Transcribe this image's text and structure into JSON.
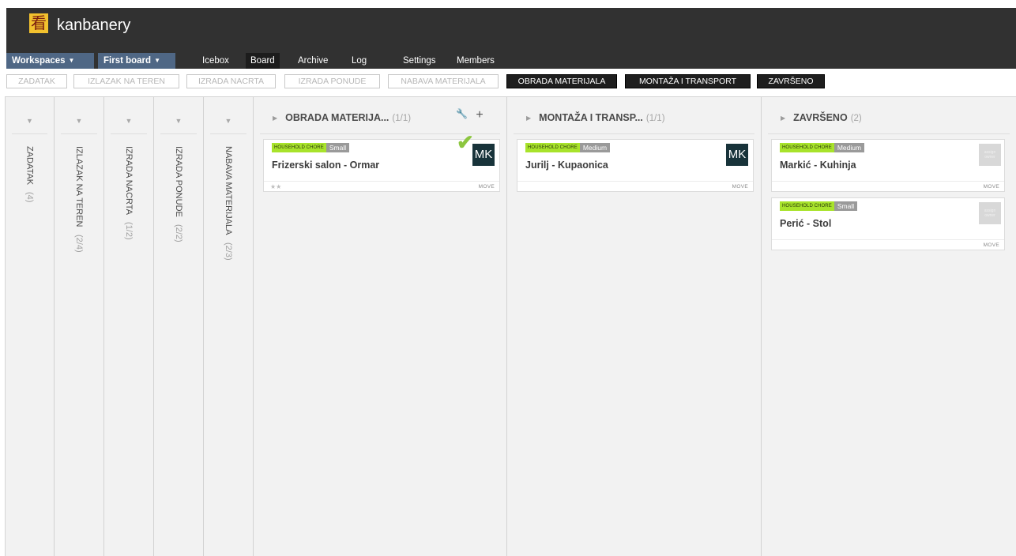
{
  "header": {
    "logo_char": "看",
    "app_name": "kanbanery",
    "workspaces_label": "Workspaces",
    "board_dropdown_label": "First board",
    "caret": "▼",
    "nav": [
      {
        "label": "Icebox",
        "active": false
      },
      {
        "label": "Board",
        "active": true
      },
      {
        "label": "Archive",
        "active": false
      },
      {
        "label": "Log",
        "active": false
      },
      {
        "label": "Settings",
        "active": false
      },
      {
        "label": "Members",
        "active": false
      }
    ]
  },
  "filters": [
    {
      "label": "ZADATAK",
      "active": false
    },
    {
      "label": "IZLAZAK NA TEREN",
      "active": false
    },
    {
      "label": "IZRADA NACRTA",
      "active": false
    },
    {
      "label": "IZRADA PONUDE",
      "active": false
    },
    {
      "label": "NABAVA MATERIJALA",
      "active": false
    },
    {
      "label": "OBRADA MATERIJALA",
      "active": true
    },
    {
      "label": "MONTAŽA I TRANSPORT",
      "active": true
    },
    {
      "label": "ZAVRŠENO",
      "active": true
    }
  ],
  "collapsed_columns": [
    {
      "name": "ZADATAK",
      "count": "(4)"
    },
    {
      "name": "IZLAZAK NA TEREN",
      "count": "(2/4)"
    },
    {
      "name": "IZRADA NACRTA",
      "count": "(1/2)"
    },
    {
      "name": "IZRADA PONUDE",
      "count": "(2/2)"
    },
    {
      "name": "NABAVA MATERIJALA",
      "count": "(2/3)"
    }
  ],
  "columns": [
    {
      "name": "OBRADA MATERIJA...",
      "count": "(1/1)",
      "tools": {
        "wrench": "🔧",
        "plus": "+"
      },
      "cards": [
        {
          "type": "HOUSEHOLD CHORE",
          "size": "Small",
          "title": "Frizerski salon - Ormar",
          "avatar": "MK",
          "stars": "★★",
          "move": "MOVE",
          "done_check": "✔"
        }
      ]
    },
    {
      "name": "MONTAŽA I TRANSP...",
      "count": "(1/1)",
      "cards": [
        {
          "type": "HOUSEHOLD CHORE",
          "size": "Medium",
          "title": "Jurilj - Kupaonica",
          "avatar": "MK",
          "move": "MOVE"
        }
      ]
    },
    {
      "name": "ZAVRŠENO",
      "count": "(2)",
      "cards": [
        {
          "type": "HOUSEHOLD CHORE",
          "size": "Medium",
          "title": "Markić - Kuhinja",
          "avatar_placeholder": "assign owner",
          "move": "MOVE"
        },
        {
          "type": "HOUSEHOLD CHORE",
          "size": "Small",
          "title": "Perić - Stol",
          "avatar_placeholder": "assign owner",
          "move": "MOVE"
        }
      ]
    }
  ],
  "colors": {
    "topbar": "#313131",
    "dropdown": "#4f6785",
    "tag_type": "#a8e32b",
    "tag_size": "#9a9a9a",
    "avatar": "#18333a",
    "check": "#8cc63f"
  }
}
